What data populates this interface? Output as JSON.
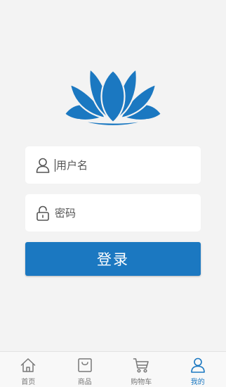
{
  "login": {
    "username_placeholder": "用户名",
    "password_placeholder": "密码",
    "submit_label": "登录"
  },
  "tabs": [
    {
      "label": "首页",
      "icon": "home-icon"
    },
    {
      "label": "商品",
      "icon": "shopping-bag-icon"
    },
    {
      "label": "购物车",
      "icon": "cart-icon"
    },
    {
      "label": "我的",
      "icon": "user-icon",
      "active": true
    }
  ],
  "colors": {
    "accent": "#1b78c1",
    "background": "#f3f3f3",
    "tab_inactive": "#777777"
  }
}
